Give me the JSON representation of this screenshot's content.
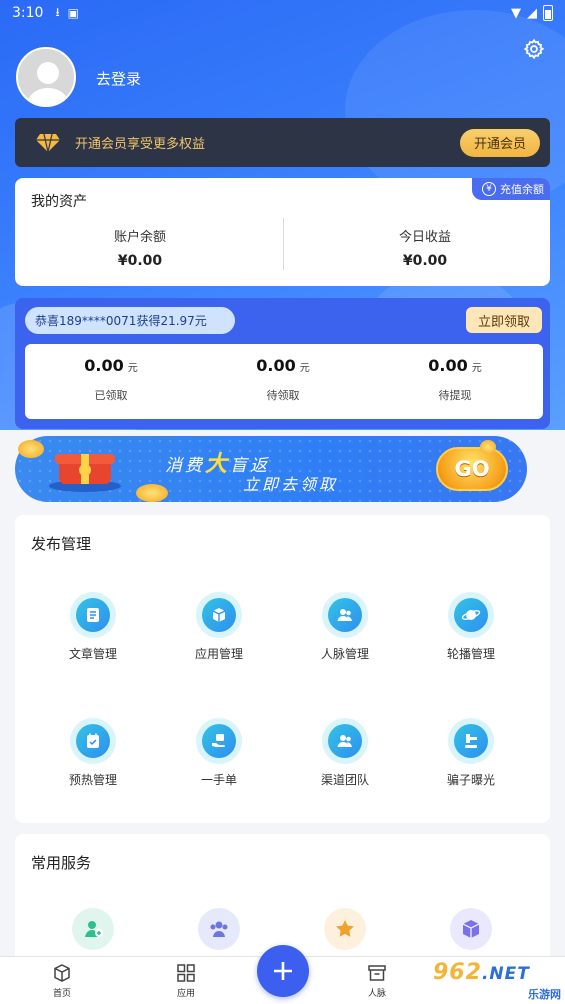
{
  "status_bar": {
    "time": "3:10"
  },
  "header": {
    "login_label": "去登录"
  },
  "vip": {
    "text": "开通会员享受更多权益",
    "button": "开通会员"
  },
  "assets": {
    "title": "我的资产",
    "recharge_label": "充值余额",
    "recharge_symbol": "¥",
    "balance_label": "账户余额",
    "balance_value": "¥0.00",
    "today_label": "今日收益",
    "today_value": "¥0.00"
  },
  "rebate": {
    "notice": "恭喜189****0071获得21.97元",
    "claim_button": "立即领取",
    "unit": "元",
    "stats": [
      {
        "value": "0.00",
        "label": "已领取"
      },
      {
        "value": "0.00",
        "label": "待领取"
      },
      {
        "value": "0.00",
        "label": "待提现"
      }
    ]
  },
  "banner": {
    "line1_a": "消费",
    "line1_big": "大",
    "line1_b": "盲返",
    "line2": "立即去领取",
    "go": "GO"
  },
  "publish": {
    "title": "发布管理",
    "items": [
      {
        "label": "文章管理",
        "icon": "document-icon"
      },
      {
        "label": "应用管理",
        "icon": "box-icon"
      },
      {
        "label": "人脉管理",
        "icon": "people-icon"
      },
      {
        "label": "轮播管理",
        "icon": "planet-icon"
      },
      {
        "label": "预热管理",
        "icon": "calendar-icon"
      },
      {
        "label": "一手单",
        "icon": "hand-icon"
      },
      {
        "label": "渠道团队",
        "icon": "team-icon"
      },
      {
        "label": "骗子曝光",
        "icon": "hammer-icon"
      }
    ]
  },
  "services": {
    "title": "常用服务",
    "items": [
      {
        "icon": "add-user-icon",
        "color": "#2fbf8f",
        "bg": "#dff5ee"
      },
      {
        "icon": "group-icon",
        "color": "#6c76e0",
        "bg": "#e6e8fb"
      },
      {
        "icon": "star-icon",
        "color": "#f0a22c",
        "bg": "#fdf0dc"
      },
      {
        "icon": "cube-icon",
        "color": "#7a72ea",
        "bg": "#e9e8fc"
      }
    ]
  },
  "tabbar": {
    "home": "首页",
    "apps": "应用",
    "contacts": "人脉"
  },
  "watermark": {
    "brand": "962",
    "net": ".NET",
    "sub": "乐游网"
  },
  "colors": {
    "primary": "#3d5ff0",
    "vip_bg": "#2c3446",
    "gold": "#f1b540"
  }
}
